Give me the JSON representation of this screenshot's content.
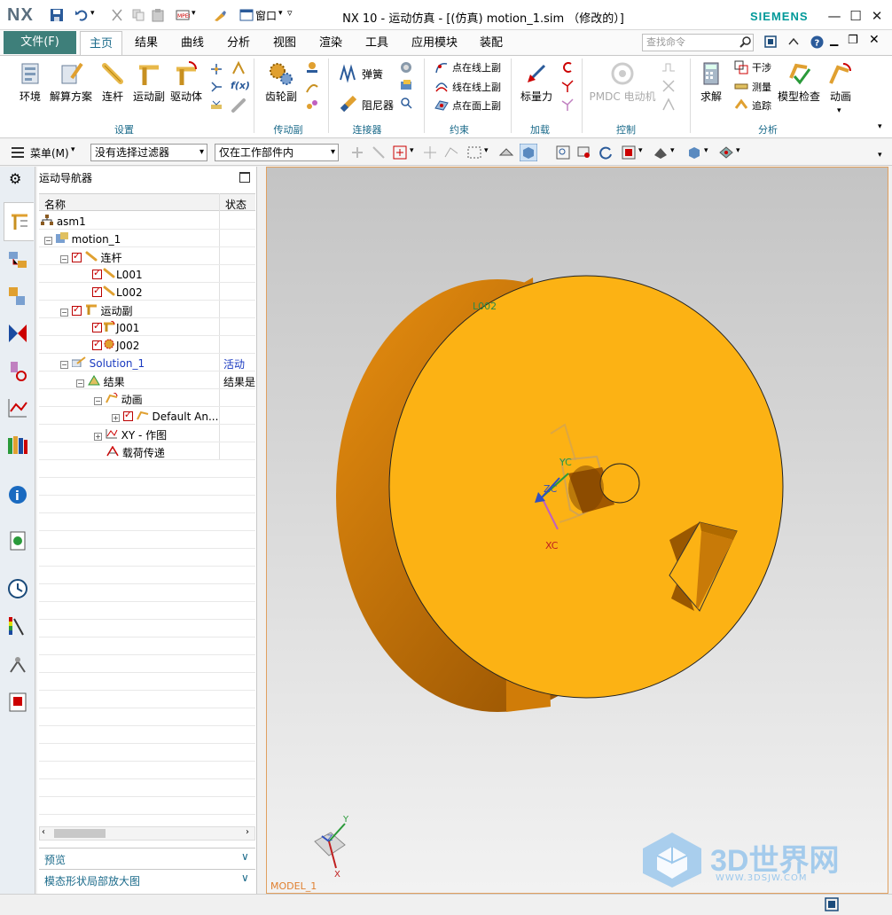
{
  "app": {
    "logo": "NX",
    "title": "NX 10 - 运动仿真 - [(仿真) motion_1.sim （修改的）]",
    "brand": "SIEMENS",
    "window_menu": "窗口"
  },
  "menu": {
    "file": "文件(F)",
    "tabs": [
      "主页",
      "结果",
      "曲线",
      "分析",
      "视图",
      "渲染",
      "工具",
      "应用模块",
      "装配"
    ],
    "active_tab": "主页",
    "search_placeholder": "查找命令"
  },
  "ribbon": {
    "setup": {
      "env": "环境",
      "solution": "解算方案",
      "link": "连杆",
      "joint": "运动副",
      "driver": "驱动体",
      "group": "设置"
    },
    "transmission": {
      "gear": "齿轮副",
      "group": "传动副"
    },
    "connector": {
      "spring": "弹簧",
      "damper": "阻尼器",
      "group": "连接器"
    },
    "constraint": {
      "point_curve": "点在线上副",
      "curve_curve": "线在线上副",
      "point_face": "点在面上副",
      "group": "约束"
    },
    "load": {
      "scalar_force": "标量力",
      "group": "加载"
    },
    "control": {
      "pmdc": "PMDC 电动机",
      "group": "控制"
    },
    "analysis": {
      "solve": "求解",
      "interference": "干涉",
      "measure": "测量",
      "trace": "追踪",
      "model_check": "模型检查",
      "animation": "动画",
      "group": "分析"
    }
  },
  "toolbar": {
    "menu_btn": "菜单(M)",
    "filter": "没有选择过滤器",
    "scope": "仅在工作部件内"
  },
  "navigator": {
    "title": "运动导航器",
    "col_name": "名称",
    "col_state": "状态",
    "rows": [
      {
        "label": "asm1",
        "state": ""
      },
      {
        "label": "motion_1",
        "state": ""
      },
      {
        "label": "连杆",
        "state": ""
      },
      {
        "label": "L001",
        "state": ""
      },
      {
        "label": "L002",
        "state": ""
      },
      {
        "label": "运动副",
        "state": ""
      },
      {
        "label": "J001",
        "state": ""
      },
      {
        "label": "J002",
        "state": ""
      },
      {
        "label": "Solution_1",
        "state": "活动"
      },
      {
        "label": "结果",
        "state": "结果是"
      },
      {
        "label": "动画",
        "state": ""
      },
      {
        "label": "Default An...",
        "state": ""
      },
      {
        "label": "XY - 作图",
        "state": ""
      },
      {
        "label": "载荷传递",
        "state": ""
      }
    ],
    "panel_preview": "预览",
    "panel_modal": "模态形状局部放大图"
  },
  "viewport": {
    "link_label": "L002",
    "axis_yc": "YC",
    "axis_zc": "ZC",
    "axis_xc": "XC",
    "triad_y": "Y",
    "triad_z": "Z",
    "triad_x": "X",
    "model_label": "MODEL_1",
    "watermark": "3D世界网",
    "watermark_url": "WWW.3DSJW.COM"
  },
  "colors": {
    "accent": "#3e7f7a",
    "tab_text": "#1a6a8a",
    "disk_face": "#fcb214",
    "disk_side": "#d07c08",
    "check_red": "#cc0000"
  }
}
